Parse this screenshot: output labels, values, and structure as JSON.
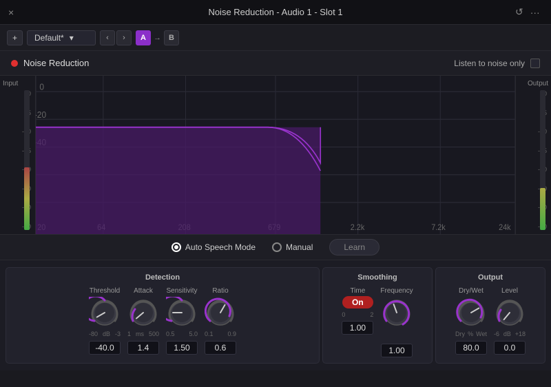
{
  "titleBar": {
    "title": "Noise Reduction - Audio 1 -  Slot 1",
    "closeIcon": "×",
    "historyIcon": "↺",
    "menuIcon": "···"
  },
  "toolbar": {
    "addLabel": "+",
    "preset": "Default*",
    "navPrev": "‹",
    "navNext": "›",
    "btnA": "A",
    "btnB": "B",
    "arrowAB": "→"
  },
  "pluginHeader": {
    "name": "Noise Reduction",
    "listenLabel": "Listen to noise only"
  },
  "graphLabels": {
    "input": "Input",
    "output": "Output",
    "inputTicks": [
      "0",
      "-5",
      "-10",
      "-15",
      "-20",
      "-30",
      "-40",
      "-50"
    ],
    "outputTicks": [
      "0",
      "-5",
      "-10",
      "-15",
      "-20",
      "-30",
      "-40",
      "-50"
    ],
    "freqTicks": [
      "20",
      "64",
      "208",
      "679",
      "2.2k",
      "7.2k",
      "24k"
    ]
  },
  "modeBar": {
    "autoSpeechMode": "Auto Speech Mode",
    "manual": "Manual",
    "learn": "Learn"
  },
  "detection": {
    "title": "Detection",
    "threshold": {
      "label": "Threshold",
      "min": "-80",
      "max": "-3",
      "unit": "dB",
      "value": "-40.0",
      "angle": -120
    },
    "attack": {
      "label": "Attack",
      "min": "1",
      "max": "500",
      "unit": "ms",
      "value": "1.4",
      "angle": -130
    },
    "sensitivity": {
      "label": "Sensitivity",
      "min": "0.5",
      "max": "5.0",
      "value": "1.50",
      "angle": -90
    },
    "ratio": {
      "label": "Ratio",
      "min": "0.1",
      "max": "0.9",
      "value": "0.6",
      "angle": 30
    }
  },
  "smoothing": {
    "title": "Smoothing",
    "frequency": {
      "label": "Frequency",
      "value": "1.00",
      "angle": -20
    },
    "time": {
      "label": "Time",
      "min": "0",
      "max": "2",
      "onLabel": "On"
    }
  },
  "output": {
    "title": "Output",
    "dryWet": {
      "label": "Dry/Wet",
      "minLabel": "Dry",
      "maxLabel": "Wet",
      "unit": "%",
      "value": "80.0",
      "angle": 60
    },
    "level": {
      "label": "Level",
      "min": "-6",
      "max": "+18",
      "unit": "dB",
      "value": "0.0",
      "angle": -140
    }
  }
}
